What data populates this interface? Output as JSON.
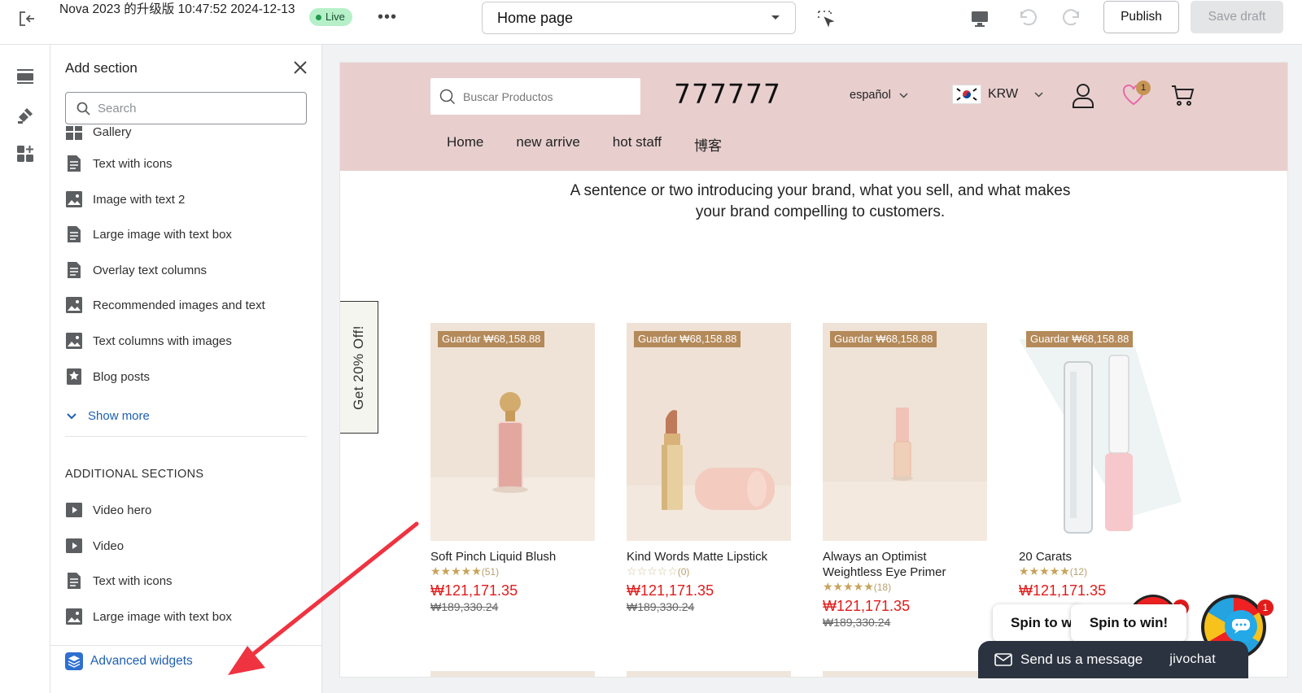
{
  "topbar": {
    "store_title": "Nova 2023 的升级版 10:47:52 2024-12-13",
    "live_label": "Live",
    "more_label": "•••",
    "page_select_value": "Home page",
    "publish_label": "Publish",
    "save_label": "Save draft"
  },
  "panel": {
    "title": "Add section",
    "search_placeholder": "Search",
    "items": [
      {
        "label": "Gallery",
        "icon": "gallery-icon"
      },
      {
        "label": "Text with icons",
        "icon": "document-icon"
      },
      {
        "label": "Image with text 2",
        "icon": "image-icon"
      },
      {
        "label": "Large image with text box",
        "icon": "document-icon"
      },
      {
        "label": "Overlay text columns",
        "icon": "document-icon"
      },
      {
        "label": "Recommended images and text",
        "icon": "image-icon"
      },
      {
        "label": "Text columns with images",
        "icon": "image-icon"
      },
      {
        "label": "Blog posts",
        "icon": "star-icon"
      }
    ],
    "show_more_label": "Show more",
    "additional_heading": "ADDITIONAL SECTIONS",
    "additional_items": [
      {
        "label": "Video hero",
        "icon": "play-icon"
      },
      {
        "label": "Video",
        "icon": "play-icon"
      },
      {
        "label": "Text with icons",
        "icon": "document-icon"
      },
      {
        "label": "Large image with text box",
        "icon": "image-icon"
      }
    ],
    "advanced_label": "Advanced widgets"
  },
  "store": {
    "search_placeholder": "Buscar Productos",
    "logo": "777777",
    "language": "español",
    "currency": "KRW",
    "wishlist_count": "1",
    "nav": [
      "Home",
      "new arrive",
      "hot staff",
      "博客"
    ],
    "intro_line1": "A sentence or two introducing your brand, what you sell, and what makes",
    "intro_line2": "your brand compelling to customers.",
    "promo_tab": "Get 20% Off!",
    "products": [
      {
        "tag": "Guardar ₩68,158.88",
        "name": "Soft Pinch Liquid Blush",
        "stars": "★★★★★",
        "reviews": "(51)",
        "price": "₩121,171.35",
        "old_price": "₩189,330.24"
      },
      {
        "tag": "Guardar ₩68,158.88",
        "name": "Kind Words Matte Lipstick",
        "stars": "☆☆☆☆☆",
        "reviews": "(0)",
        "price": "₩121,171.35",
        "old_price": "₩189,330.24"
      },
      {
        "tag": "Guardar ₩68,158.88",
        "name": "Always an Optimist Weightless Eye Primer",
        "stars": "★★★★★",
        "reviews": "(18)",
        "price": "₩121,171.35",
        "old_price": "₩189,330.24"
      },
      {
        "tag": "Guardar ₩68,158.88",
        "name": "20 Carats",
        "stars": "★★★★★",
        "reviews": "(12)",
        "price": "₩121,171.35",
        "old_price": ""
      }
    ]
  },
  "widgets": {
    "spin_label_cut": "Spin to wi",
    "spin_label": "Spin to win!",
    "spin_badge": "1",
    "chat_label": "Send us a message",
    "chat_brand": "jivochat"
  },
  "colors": {
    "header_bg": "#e8cfce",
    "price_red": "#e21b1b",
    "tag_brown": "#b48a5a",
    "link_blue": "#1f5fb3",
    "arrow_red": "#ef3340"
  }
}
